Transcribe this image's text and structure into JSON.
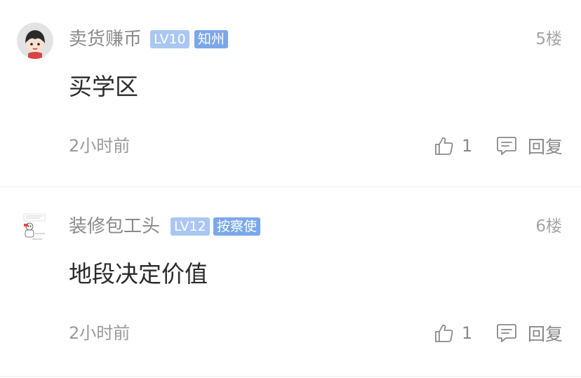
{
  "comments": [
    {
      "username": "卖货赚币",
      "level": "LV10",
      "badge": "知州",
      "floor": "5楼",
      "content": "买学区",
      "time": "2小时前",
      "likes": "1",
      "reply_label": "回复"
    },
    {
      "username": "装修包工头",
      "level": "LV12",
      "badge": "按察使",
      "floor": "6楼",
      "content": "地段决定价值",
      "time": "2小时前",
      "likes": "1",
      "reply_label": "回复"
    }
  ],
  "colors": {
    "level_tag": "#a9c7f2",
    "title_tag": "#7aa8ec",
    "divider": "#ebebeb"
  }
}
